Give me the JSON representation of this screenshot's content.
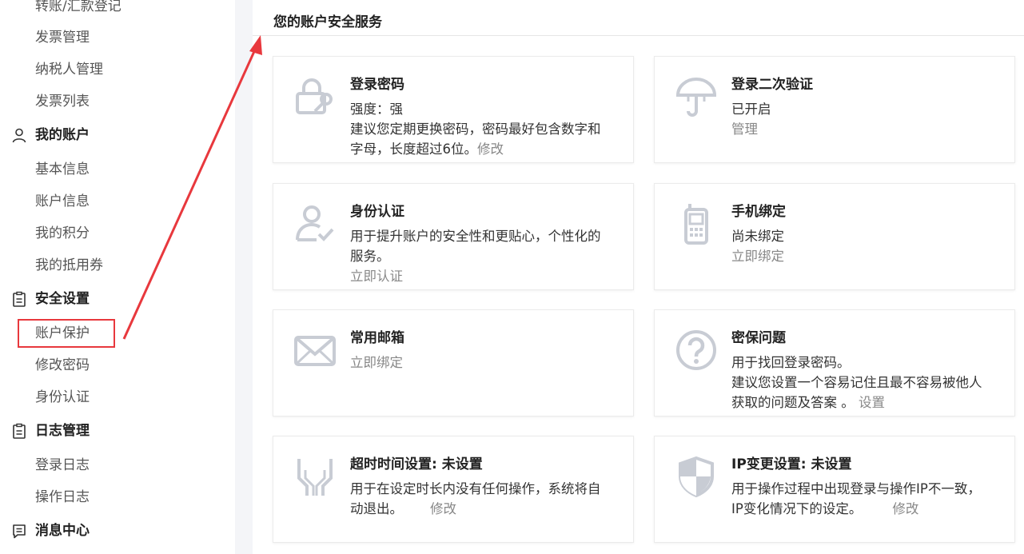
{
  "sidebar": {
    "top_partial_item": "转账/汇款登记",
    "items_top": [
      "发票管理",
      "纳税人管理",
      "发票列表"
    ],
    "group_account": {
      "title": "我的账户",
      "items": [
        "基本信息",
        "账户信息",
        "我的积分",
        "我的抵用券"
      ]
    },
    "group_security": {
      "title": "安全设置",
      "items": [
        "账户保护",
        "修改密码",
        "身份认证"
      ]
    },
    "group_logs": {
      "title": "日志管理",
      "items": [
        "登录日志",
        "操作日志"
      ]
    },
    "group_messages": {
      "title": "消息中心"
    }
  },
  "main": {
    "title": "您的账户安全服务",
    "cards": {
      "password": {
        "title": "登录密码",
        "line1": "强度：强",
        "line2": "建议您定期更换密码，密码最好包含数字和",
        "line3": "字母，长度超过6位。",
        "link": "修改"
      },
      "two_factor": {
        "title": "登录二次验证",
        "line1": "已开启",
        "link": "管理"
      },
      "identity": {
        "title": "身份认证",
        "line1": "用于提升账户的安全性和更贴心，个性化的",
        "line2": "服务。",
        "link": "立即认证"
      },
      "phone": {
        "title": "手机绑定",
        "line1": "尚未绑定",
        "link": "立即绑定"
      },
      "email": {
        "title": "常用邮箱",
        "link": "立即绑定"
      },
      "security_question": {
        "title": "密保问题",
        "line1": "用于找回登录密码。",
        "line2": "建议您设置一个容易记住且最不容易被他人",
        "line3": "获取的问题及答案 。",
        "link": "设置"
      },
      "timeout": {
        "title": "超时时间设置: 未设置",
        "line1": "用于在设定时长内没有任何操作，系统将自",
        "line2": "动退出。",
        "link": "修改"
      },
      "ip_change": {
        "title": "IP变更设置: 未设置",
        "line1": "用于操作过程中出现登录与操作IP不一致，",
        "line2": "IP变化情况下的设定。",
        "link": "修改"
      }
    }
  },
  "colors": {
    "annotation_red": "#e8383d",
    "icon_gray": "#c8ccd4",
    "link_gray": "#888888"
  }
}
